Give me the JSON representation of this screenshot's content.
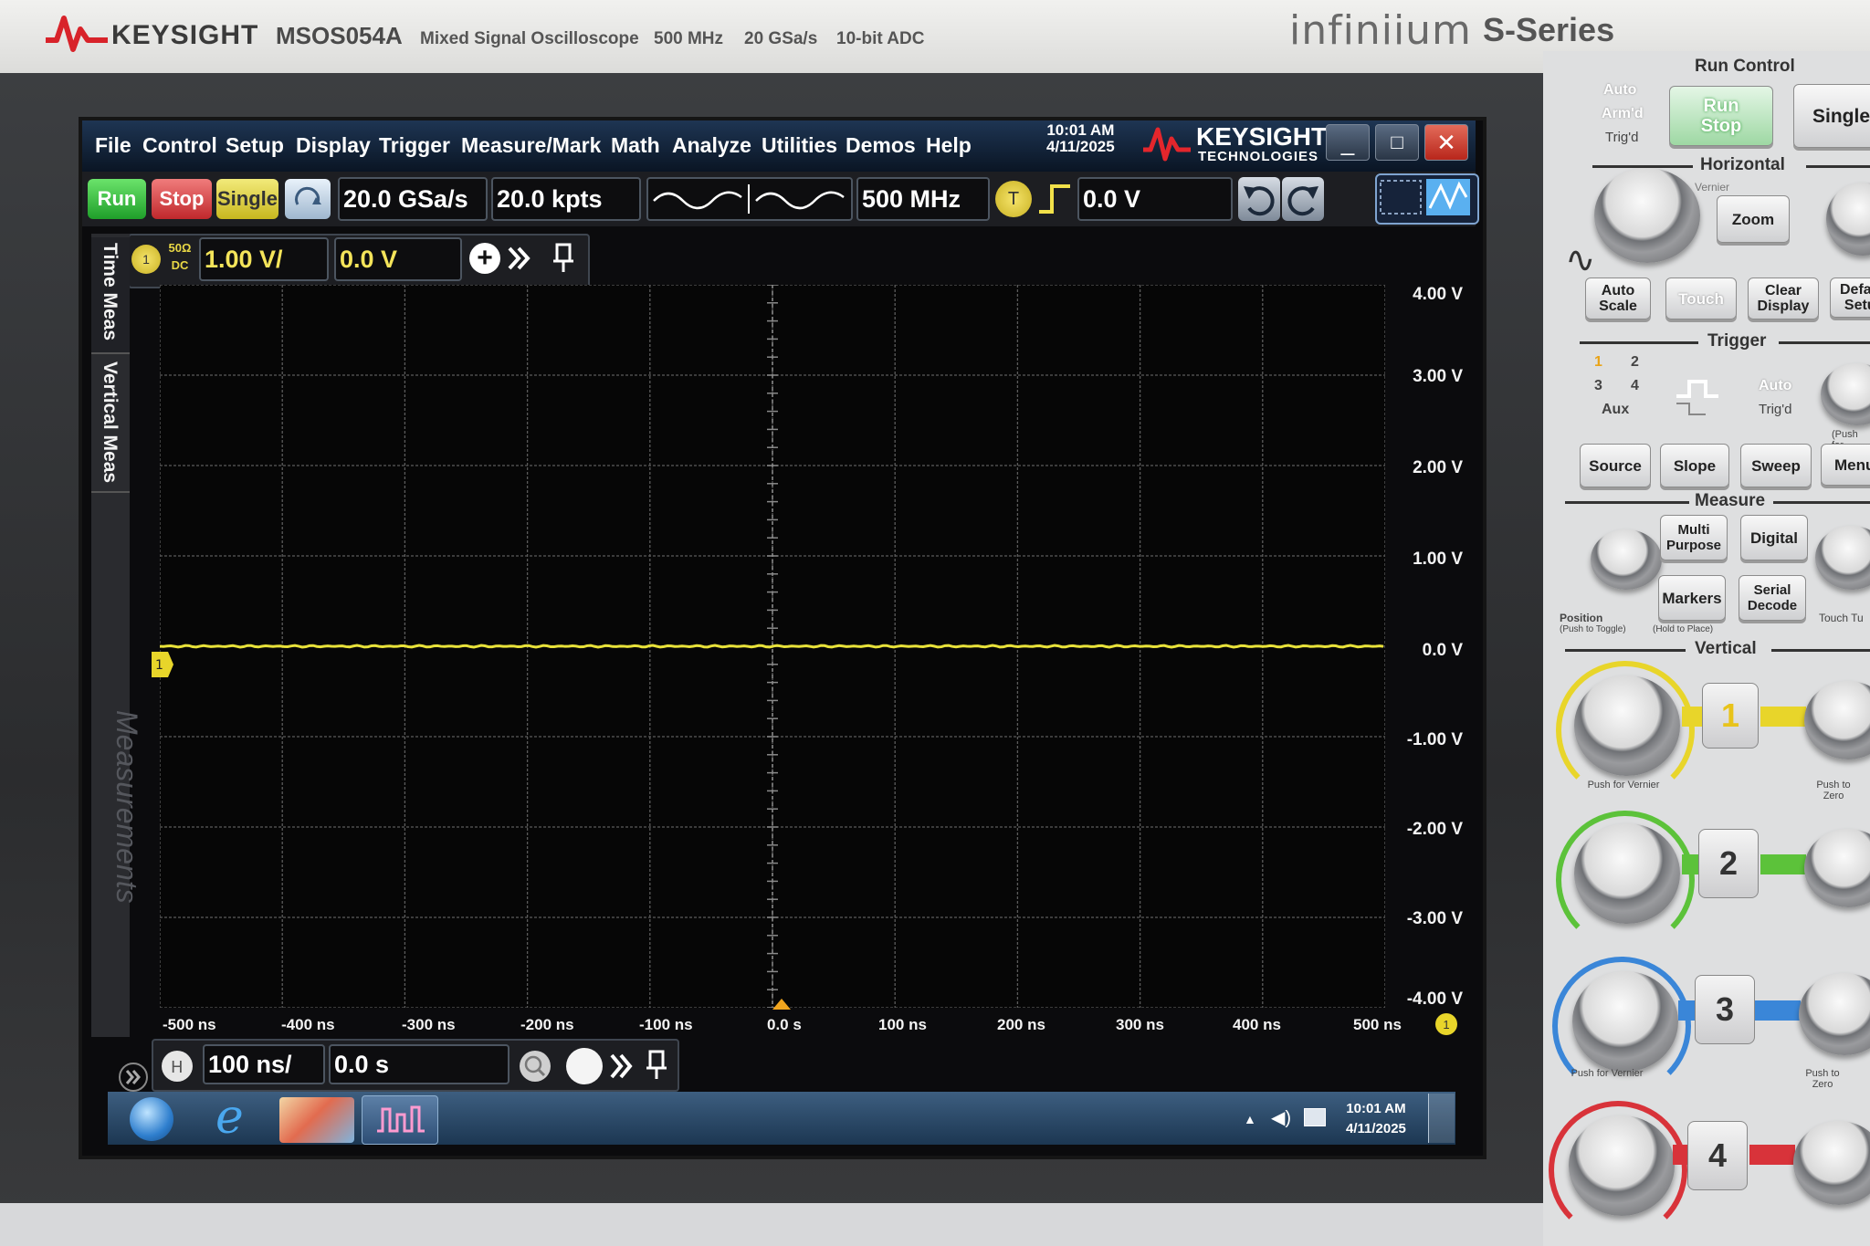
{
  "instrument": {
    "brand": "KEYSIGHT",
    "model": "MSOS054A",
    "description": "Mixed Signal Oscilloscope",
    "bandwidth": "500 MHz",
    "sample_rate": "20 GSa/s",
    "adc": "10-bit ADC",
    "series_logo": "infiniium",
    "series_name": "S-Series"
  },
  "menu": [
    "File",
    "Control",
    "Setup",
    "Display",
    "Trigger",
    "Measure/Mark",
    "Math",
    "Analyze",
    "Utilities",
    "Demos",
    "Help"
  ],
  "clock": {
    "time": "10:01 AM",
    "date": "4/11/2025"
  },
  "screen_brand": {
    "name": "KEYSIGHT",
    "sub": "TECHNOLOGIES"
  },
  "window_buttons": {
    "minimize": "_",
    "maximize": "□",
    "close": "✕"
  },
  "toolbar": {
    "run": "Run",
    "stop": "Stop",
    "single": "Single",
    "sample_rate": "20.0 GSa/s",
    "memory_depth": "20.0 kpts",
    "bandwidth": "500 MHz",
    "trigger_badge": "T",
    "trigger_level": "0.0 V"
  },
  "channel1": {
    "badge": "1",
    "impedance": "50Ω",
    "coupling": "DC",
    "scale": "1.00 V/",
    "offset": "0.0 V"
  },
  "side_tabs": {
    "time_meas": "Time Meas",
    "vertical_meas": "Vertical Meas",
    "measurements": "Measurements"
  },
  "y_axis": [
    "4.00 V",
    "3.00 V",
    "2.00 V",
    "1.00 V",
    "0.0 V",
    "-1.00 V",
    "-2.00 V",
    "-3.00 V",
    "-4.00 V"
  ],
  "x_axis": [
    "-500 ns",
    "-400 ns",
    "-300 ns",
    "-200 ns",
    "-100 ns",
    "0.0 s",
    "100 ns",
    "200 ns",
    "300 ns",
    "400 ns",
    "500 ns"
  ],
  "horizontal": {
    "scale": "100 ns/",
    "position": "0.0 s"
  },
  "trace": {
    "channel": 1,
    "level_v": 0.0,
    "color": "#e8e23a"
  },
  "taskbar": {
    "time": "10:01 AM",
    "date": "4/11/2025"
  },
  "panel": {
    "run_control": {
      "title": "Run Control",
      "auto_label": "Auto",
      "armd_label": "Arm'd",
      "trigd_label": "Trig'd",
      "run": "Run",
      "stop": "Stop",
      "single": "Single"
    },
    "horizontal": {
      "title": "Horizontal",
      "zoom": "Zoom",
      "vernier": "Vernier"
    },
    "general": {
      "auto_scale": "Auto Scale",
      "touch": "Touch",
      "clear_display": "Clear Display",
      "default_setup": "Default Setup"
    },
    "trigger": {
      "title": "Trigger",
      "ch1": "1",
      "ch2": "2",
      "ch3": "3",
      "ch4": "4",
      "aux": "Aux",
      "auto": "Auto",
      "trigd": "Trig'd",
      "push_for": "(Push for",
      "source": "Source",
      "slope": "Slope",
      "sweep": "Sweep",
      "menu": "Menu"
    },
    "measure": {
      "title": "Measure",
      "multipurpose": "Multi Purpose",
      "digital": "Digital",
      "markers": "Markers",
      "serial_decode": "Serial Decode",
      "position": "Position",
      "push_toggle": "(Push to Toggle)",
      "hold_place": "(Hold to Place)",
      "touch_tune": "Touch Tu"
    },
    "vertical": {
      "title": "Vertical",
      "push_vernier": "Push for Vernier",
      "push_zero": "Push to Zero",
      "channels": [
        {
          "label": "1",
          "color": "#e8d52a"
        },
        {
          "label": "2",
          "color": "#5cc23a"
        },
        {
          "label": "3",
          "color": "#3a86d8"
        },
        {
          "label": "4",
          "color": "#d8333a"
        }
      ]
    }
  }
}
